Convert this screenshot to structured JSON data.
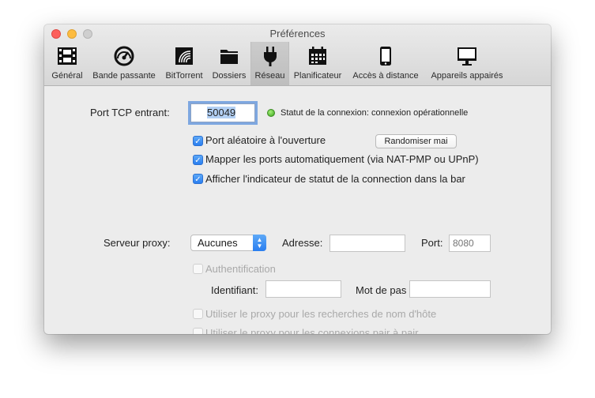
{
  "window": {
    "title": "Préférences"
  },
  "toolbar": {
    "tabs": [
      {
        "label": "Général",
        "icon": "film-icon"
      },
      {
        "label": "Bande passante",
        "icon": "speedometer-icon"
      },
      {
        "label": "BitTorrent",
        "icon": "bittorrent-icon"
      },
      {
        "label": "Dossiers",
        "icon": "folder-icon"
      },
      {
        "label": "Réseau",
        "icon": "plug-icon",
        "selected": true
      },
      {
        "label": "Planificateur",
        "icon": "calendar-icon"
      },
      {
        "label": "Accès à distance",
        "icon": "mobile-icon"
      },
      {
        "label": "Appareils appairés",
        "icon": "monitor-icon"
      }
    ]
  },
  "network": {
    "port_label": "Port TCP entrant:",
    "port_value": "50049",
    "status_text": "Statut de la connexion: connexion opérationnelle",
    "status_color": "#3aa31a",
    "random_port_label": "Port aléatoire à l'ouverture",
    "randomize_button": "Randomiser mai",
    "map_ports_label": "Mapper les ports automatiquement (via NAT-PMP ou UPnP)",
    "show_status_label": "Afficher l'indicateur de statut de la connection dans la bar"
  },
  "proxy": {
    "server_label": "Serveur proxy:",
    "type_value": "Aucunes",
    "address_label": "Adresse:",
    "address_value": "",
    "port_label": "Port:",
    "port_placeholder": "8080",
    "auth_label": "Authentification",
    "username_label": "Identifiant:",
    "username_value": "",
    "password_label": "Mot de pas",
    "password_value": "",
    "hostname_lookup_label": "Utiliser le proxy pour les recherches de nom d'hôte",
    "p2p_label": "Utiliser le proxy pour les connexions pair à pair"
  },
  "colors": {
    "accent": "#2a7ef0",
    "window_bg": "#ececec"
  }
}
